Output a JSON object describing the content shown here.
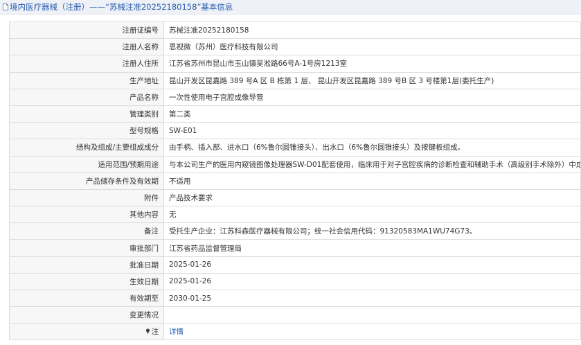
{
  "header": {
    "title": "境内医疗器械（注册）——“苏械注准20252180158”基本信息"
  },
  "fields": [
    {
      "label": "注册证编号",
      "value": "苏械注准20252180158"
    },
    {
      "label": "注册人名称",
      "value": "恩视微（苏州）医疗科技有限公司"
    },
    {
      "label": "注册人住所",
      "value": "江苏省苏州市昆山市玉山镇吴淞路66号A-1号房1213室"
    },
    {
      "label": "生产地址",
      "value": "昆山开发区昆嘉路 389 号A 区 B 栋第 1 层、 昆山开发区昆嘉路 389 号B 区 3 号楼第1层(委托生产)"
    },
    {
      "label": "产品名称",
      "value": "一次性使用电子宫腔成像导管"
    },
    {
      "label": "管理类别",
      "value": "第二类"
    },
    {
      "label": "型号规格",
      "value": "SW-E01"
    },
    {
      "label": "结构及组成/主要组成成分",
      "value": "由手柄、插入部、进水口（6%鲁尔圆锥接头）、出水口（6%鲁尔圆锥接头）及按键板组成。"
    },
    {
      "label": "适用范围/预期用途",
      "value": "与本公司生产的医用内窥镜图像处理器SW-D01配套使用，临床用于对子宫腔疾病的诊断检查和辅助手术（高级别手术除外）中成像"
    },
    {
      "label": "产品储存条件及有效期",
      "value": "不适用"
    },
    {
      "label": "附件",
      "value": "产品技术要求"
    },
    {
      "label": "其他内容",
      "value": "无"
    },
    {
      "label": "备注",
      "value": "受托生产企业：江苏科森医疗器械有限公司；统一社会信用代码：91320583MA1WU74G73。"
    },
    {
      "label": "审批部门",
      "value": "江苏省药品监督管理局"
    },
    {
      "label": "批准日期",
      "value": "2025-01-26"
    },
    {
      "label": "生效日期",
      "value": "2025-01-26"
    },
    {
      "label": "有效期至",
      "value": "2030-01-25"
    },
    {
      "label": "变更情况",
      "value": ""
    }
  ],
  "note": {
    "label": "注",
    "icon": "pin-icon",
    "link_text": "详情"
  }
}
